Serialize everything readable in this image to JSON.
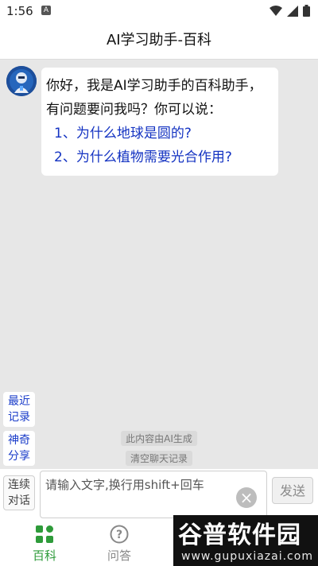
{
  "status_bar": {
    "time": "1:56",
    "notif_letter": "A"
  },
  "header": {
    "title": "AI学习助手-百科"
  },
  "chat": {
    "greeting": "你好，我是AI学习助手的百科助手，有问题要问我吗？你可以说：",
    "suggestions": [
      "1、为什么地球是圆的?",
      "2、为什么植物需要光合作用?"
    ]
  },
  "side_buttons": {
    "history": "最近记录",
    "share": "神奇分享"
  },
  "notices": {
    "ai_generated": "此内容由AI生成",
    "clear_history": "清空聊天记录"
  },
  "input_bar": {
    "continuous_label": "连续对话",
    "placeholder": "请输入文字,换行用shift+回车",
    "send_label": "发送"
  },
  "tabs": [
    {
      "label": "百科",
      "active": true
    },
    {
      "label": "问答",
      "active": false
    }
  ],
  "watermark": {
    "title": "谷普软件园",
    "url": "www.gupuxiazai.com"
  },
  "colors": {
    "accent_green": "#2e9b3a",
    "link_blue": "#1433c2",
    "background": "#e7e7e7"
  }
}
